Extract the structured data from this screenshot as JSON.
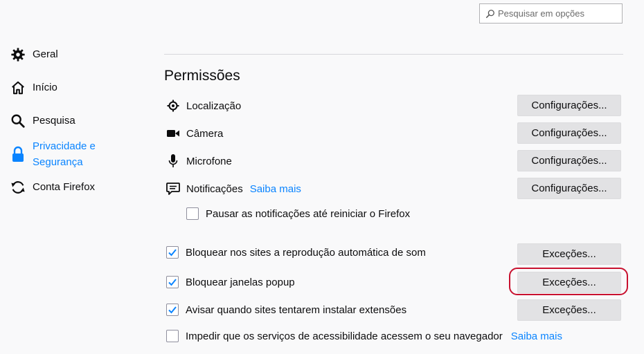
{
  "search": {
    "placeholder": "Pesquisar em opções"
  },
  "sidebar": {
    "items": [
      {
        "label": "Geral",
        "icon": "gear-icon"
      },
      {
        "label": "Início",
        "icon": "home-icon"
      },
      {
        "label": "Pesquisa",
        "icon": "search-icon"
      },
      {
        "label": "Privacidade e\nSegurança",
        "icon": "lock-icon",
        "selected": true
      },
      {
        "label": "Conta Firefox",
        "icon": "sync-icon"
      }
    ]
  },
  "permissions": {
    "title": "Permissões",
    "settings_label": "Configurações...",
    "exceptions_label": "Exceções...",
    "location": "Localização",
    "camera": "Câmera",
    "microphone": "Microfone",
    "notifications": "Notificações",
    "learn_more": "Saiba mais",
    "pause_notifications": {
      "label": "Pausar as notificações até reiniciar o Firefox",
      "checked": false
    },
    "block_autoplay": {
      "label": "Bloquear nos sites a reprodução automática de som",
      "checked": true
    },
    "block_popups": {
      "label": "Bloquear janelas popup",
      "checked": true
    },
    "warn_addons": {
      "label": "Avisar quando sites tentarem instalar extensões",
      "checked": true
    },
    "block_accessibility": {
      "label": "Impedir que os serviços de acessibilidade acessem o seu navegador",
      "checked": false
    }
  },
  "colors": {
    "accent": "#0a84ff",
    "highlight": "#c8102e"
  }
}
